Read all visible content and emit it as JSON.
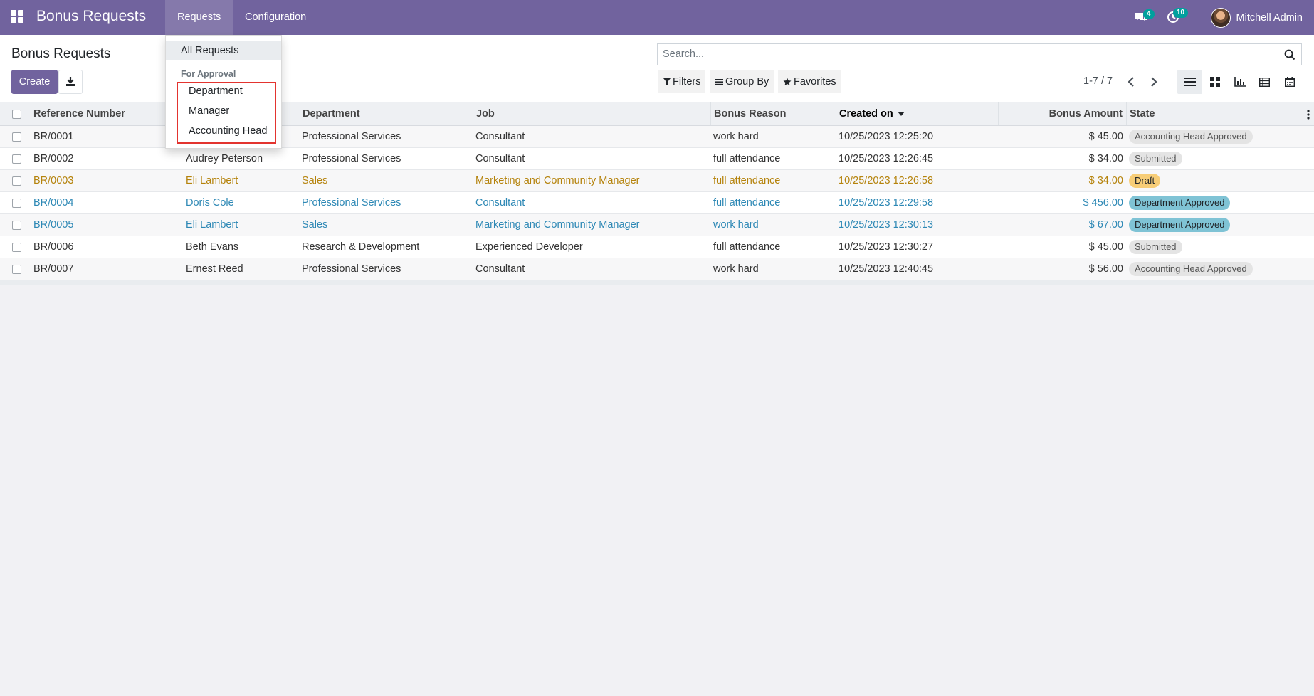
{
  "app": {
    "title": "Bonus Requests"
  },
  "navbar": {
    "menus": [
      "Requests",
      "Configuration"
    ],
    "messages_badge": "4",
    "activities_badge": "10",
    "user_name": "Mitchell Admin"
  },
  "control_panel": {
    "title": "Bonus Requests",
    "create_label": "Create",
    "search_placeholder": "Search...",
    "filters_label": "Filters",
    "group_by_label": "Group By",
    "favorites_label": "Favorites",
    "pager": "1-7 / 7"
  },
  "requests_menu": {
    "all_requests": "All Requests",
    "section_header": "For Approval",
    "approval_items": [
      "Department",
      "Manager",
      "Accounting Head"
    ]
  },
  "table": {
    "columns": [
      "Reference Number",
      "Department",
      "Job",
      "Bonus Reason",
      "Created on",
      "Bonus Amount",
      "State"
    ],
    "rows": [
      {
        "ref": "BR/0001",
        "employee": "",
        "department": "Professional Services",
        "job": "Consultant",
        "reason": "work hard",
        "created": "10/25/2023 12:25:20",
        "amount": "$ 45.00",
        "state": "Accounting Head Approved",
        "decoration": "muted"
      },
      {
        "ref": "BR/0002",
        "employee": "Audrey Peterson",
        "department": "Professional Services",
        "job": "Consultant",
        "reason": "full attendance",
        "created": "10/25/2023 12:26:45",
        "amount": "$ 34.00",
        "state": "Submitted",
        "decoration": "muted"
      },
      {
        "ref": "BR/0003",
        "employee": "Eli Lambert",
        "department": "Sales",
        "job": "Marketing and Community Manager",
        "reason": "full attendance",
        "created": "10/25/2023 12:26:58",
        "amount": "$ 34.00",
        "state": "Draft",
        "decoration": "warning"
      },
      {
        "ref": "BR/0004",
        "employee": "Doris Cole",
        "department": "Professional Services",
        "job": "Consultant",
        "reason": "full attendance",
        "created": "10/25/2023 12:29:58",
        "amount": "$ 456.00",
        "state": "Department Approved",
        "decoration": "info"
      },
      {
        "ref": "BR/0005",
        "employee": "Eli Lambert",
        "department": "Sales",
        "job": "Marketing and Community Manager",
        "reason": "work hard",
        "created": "10/25/2023 12:30:13",
        "amount": "$ 67.00",
        "state": "Department Approved",
        "decoration": "info"
      },
      {
        "ref": "BR/0006",
        "employee": "Beth Evans",
        "department": "Research & Development",
        "job": "Experienced Developer",
        "reason": "full attendance",
        "created": "10/25/2023 12:30:27",
        "amount": "$ 45.00",
        "state": "Submitted",
        "decoration": "muted"
      },
      {
        "ref": "BR/0007",
        "employee": "Ernest Reed",
        "department": "Professional Services",
        "job": "Consultant",
        "reason": "work hard",
        "created": "10/25/2023 12:40:45",
        "amount": "$ 56.00",
        "state": "Accounting Head Approved",
        "decoration": "muted"
      }
    ]
  },
  "colors": {
    "brand": "#71639e",
    "badge_grey": "#e4e4e4",
    "badge_warning": "#f7cd77",
    "badge_info": "#7fc3d5",
    "highlight": "#e3342f"
  }
}
